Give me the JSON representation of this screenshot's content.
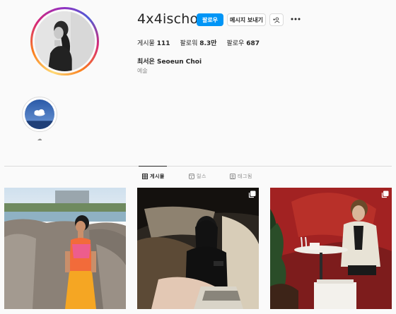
{
  "profile": {
    "username": "4x4ischoi",
    "follow_label": "팔로우",
    "message_label": "메시지 보내기",
    "suggest_icon": "add-user-icon",
    "more_icon": "more-icon",
    "full_name": "최서은 Seoeun Choi",
    "category": "예술"
  },
  "stats": {
    "posts_label": "게시물",
    "posts_value": "111",
    "followers_label": "팔로워",
    "followers_value": "8.3만",
    "following_label": "팔로우",
    "following_value": "687"
  },
  "highlights": [
    {
      "label": "☁"
    }
  ],
  "tabs": [
    {
      "label": "게시물",
      "icon": "grid-icon",
      "active": true
    },
    {
      "label": "릴스",
      "icon": "reels-icon",
      "active": false
    },
    {
      "label": "태그됨",
      "icon": "tag-icon",
      "active": false
    }
  ],
  "colors": {
    "accent": "#0095f6",
    "text": "#262626",
    "muted": "#8e8e8e",
    "border": "#dbdbdb",
    "background": "#fafafa"
  }
}
